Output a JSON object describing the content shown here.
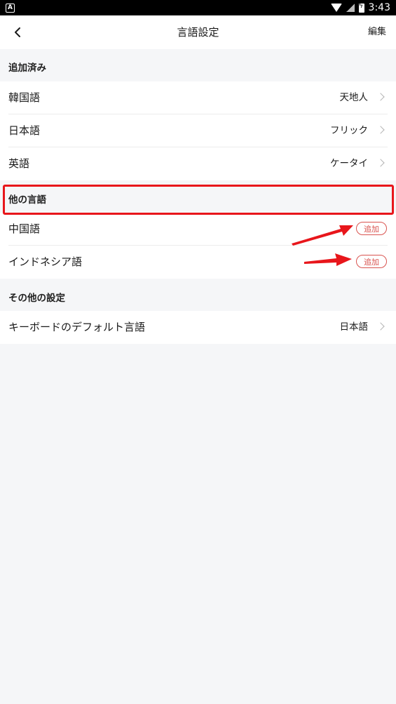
{
  "status_bar": {
    "time": "3:43",
    "app_badge": "A"
  },
  "header": {
    "title": "言語設定",
    "edit_label": "編集",
    "back_icon": "chevron-left-icon"
  },
  "sections": {
    "added": {
      "title": "追加済み",
      "items": [
        {
          "label": "韓国語",
          "value": "天地人"
        },
        {
          "label": "日本語",
          "value": "フリック"
        },
        {
          "label": "英語",
          "value": "ケータイ"
        }
      ]
    },
    "other_languages": {
      "title": "他の言語",
      "items": [
        {
          "label": "中国語",
          "action": "追加"
        },
        {
          "label": "インドネシア語",
          "action": "追加"
        }
      ]
    },
    "other_settings": {
      "title": "その他の設定",
      "items": [
        {
          "label": "キーボードのデフォルト言語",
          "value": "日本語"
        }
      ]
    }
  },
  "annotation": {
    "highlight_color": "#e8161b",
    "arrow_color": "#e8161b"
  }
}
